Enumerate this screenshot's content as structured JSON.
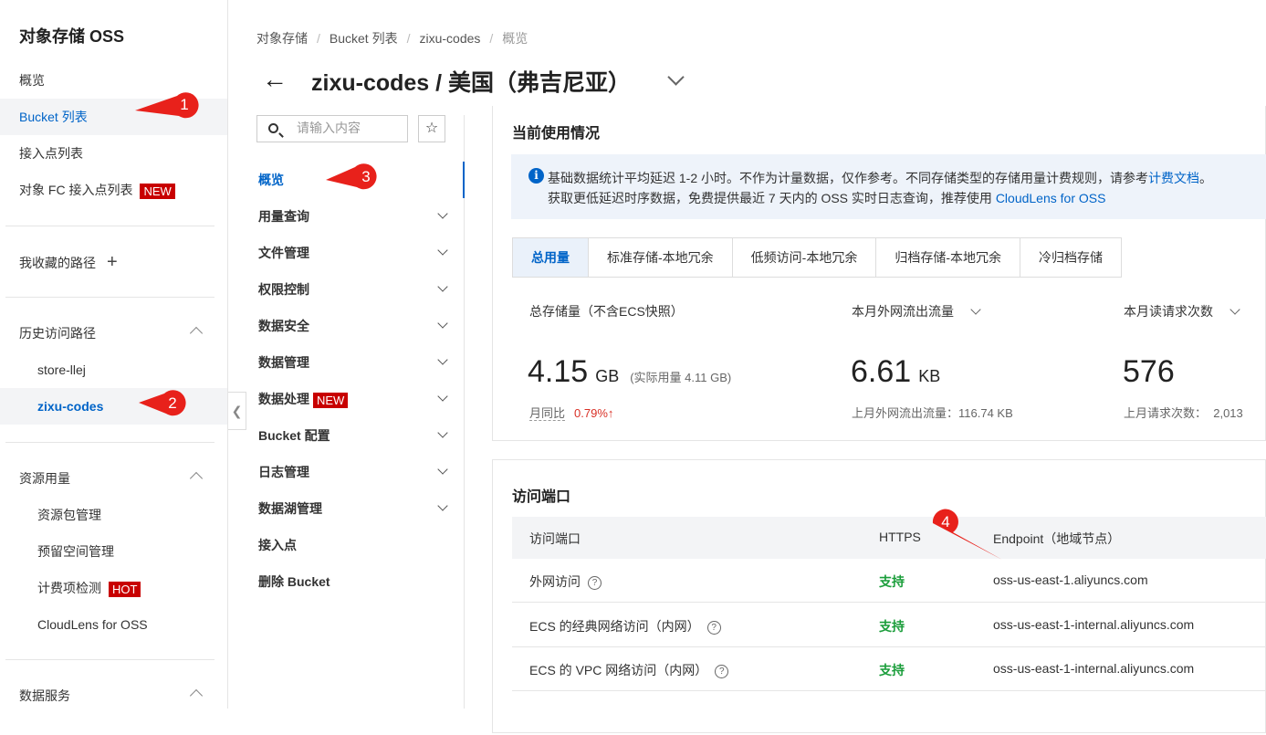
{
  "sidebar": {
    "title": "对象存储 OSS",
    "items": [
      {
        "label": "概览"
      },
      {
        "label": "Bucket 列表"
      },
      {
        "label": "接入点列表"
      },
      {
        "label": "对象 FC 接入点列表",
        "badge": "NEW"
      }
    ],
    "favorites": {
      "label": "我收藏的路径",
      "add_icon": "+"
    },
    "history": {
      "label": "历史访问路径",
      "items": [
        "store-llej",
        "zixu-codes"
      ]
    },
    "resources": {
      "label": "资源用量",
      "items": [
        {
          "label": "资源包管理"
        },
        {
          "label": "预留空间管理"
        },
        {
          "label": "计费项检测",
          "badge": "HOT"
        },
        {
          "label": "CloudLens for OSS"
        }
      ]
    },
    "data_service": {
      "label": "数据服务"
    }
  },
  "breadcrumb": [
    "对象存储",
    "Bucket 列表",
    "zixu-codes",
    "概览"
  ],
  "page_title": "zixu-codes / 美国（弗吉尼亚）",
  "search": {
    "placeholder": "请输入内容"
  },
  "bucket_nav": [
    {
      "label": "概览",
      "active": true
    },
    {
      "label": "用量查询"
    },
    {
      "label": "文件管理"
    },
    {
      "label": "权限控制"
    },
    {
      "label": "数据安全"
    },
    {
      "label": "数据管理"
    },
    {
      "label": "数据处理",
      "badge": "NEW"
    },
    {
      "label": "Bucket 配置"
    },
    {
      "label": "日志管理"
    },
    {
      "label": "数据湖管理"
    },
    {
      "label": "接入点"
    },
    {
      "label": "删除 Bucket"
    }
  ],
  "usage": {
    "title": "当前使用情况",
    "info_line1_pre": "基础数据统计平均延迟 1-2 小时。不作为计量数据，仅作参考。不同存储类型的存储用量计费规则，请参考",
    "info_line1_link": "计费文档",
    "info_line1_post": "。",
    "info_line2_pre": "获取更低延迟时序数据，免费提供最近 7 天内的 OSS 实时日志查询，推荐使用 ",
    "info_line2_link": "CloudLens for OSS",
    "tabs": [
      "总用量",
      "标准存储-本地冗余",
      "低频访问-本地冗余",
      "归档存储-本地冗余",
      "冷归档存储"
    ],
    "stats": [
      {
        "label": "总存储量（不含ECS快照）",
        "value": "4.15",
        "unit": "GB",
        "note": "(实际用量 4.11 GB)",
        "sub_label": "月同比",
        "sub_value": "0.79%",
        "trend": "↑"
      },
      {
        "label": "本月外网流出流量",
        "value": "6.61",
        "unit": "KB",
        "sub": "上月外网流出流量：116.74 KB"
      },
      {
        "label": "本月读请求次数",
        "value": "576",
        "unit": "",
        "sub": "上月请求次数：  2,013"
      }
    ]
  },
  "endpoints": {
    "title": "访问端口",
    "columns": [
      "访问端口",
      "HTTPS",
      "Endpoint（地域节点）"
    ],
    "rows": [
      {
        "name": "外网访问",
        "https": "支持",
        "endpoint": "oss-us-east-1.aliyuncs.com"
      },
      {
        "name": "ECS 的经典网络访问（内网）",
        "https": "支持",
        "endpoint": "oss-us-east-1-internal.aliyuncs.com"
      },
      {
        "name": "ECS 的 VPC 网络访问（内网）",
        "https": "支持",
        "endpoint": "oss-us-east-1-internal.aliyuncs.com"
      }
    ]
  },
  "annotations": [
    "1",
    "2",
    "3",
    "4"
  ],
  "colors": {
    "accent": "#0064c8",
    "badge": "#c80000",
    "callout": "#e8211b",
    "support": "#1a9d3a"
  }
}
